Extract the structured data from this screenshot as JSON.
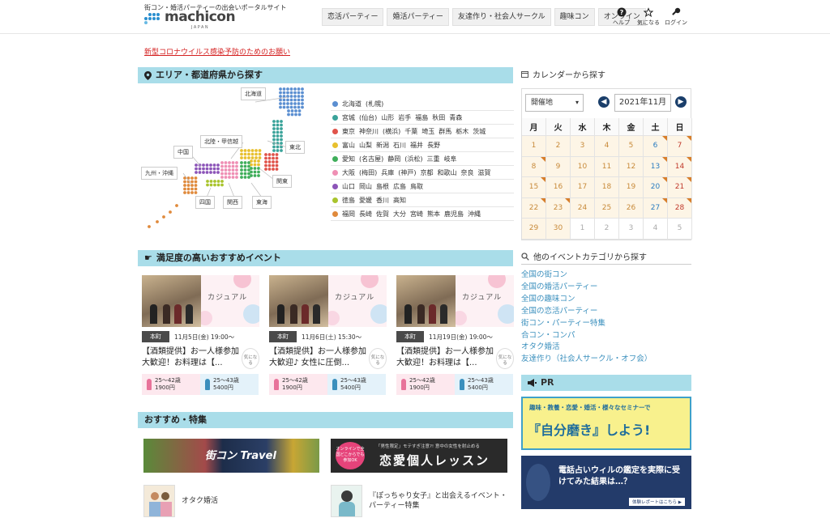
{
  "header": {
    "tagline": "街コン・婚活パーティーの出会いポータルサイト",
    "logo_text": "machicon",
    "logo_sub": "JAPAN",
    "nav": [
      "恋活パーティー",
      "婚活パーティー",
      "友達作り・社会人サークル",
      "趣味コン",
      "オンライン"
    ],
    "help": "ヘルプ",
    "favorite": "気になる",
    "login": "ログイン"
  },
  "notice": "新型コロナウイルス感染予防のためのお願い",
  "area": {
    "heading": "エリア・都道府県から探す",
    "map_labels": {
      "hokkaido": "北海道",
      "tohoku": "東北",
      "hokuriku": "北陸・甲信越",
      "chugoku": "中国",
      "kyushu": "九州・沖縄",
      "shikoku": "四国",
      "kansai": "関西",
      "tokai": "東海",
      "kanto": "関東"
    },
    "regions": [
      {
        "color": "#5b8fd1",
        "prefs": [
          "北海道",
          "(札幌)"
        ]
      },
      {
        "color": "#3aa39a",
        "prefs": [
          "宮城",
          "(仙台)",
          "山形",
          "岩手",
          "福島",
          "秋田",
          "青森"
        ]
      },
      {
        "color": "#e0534a",
        "prefs": [
          "東京",
          "神奈川",
          "(横浜)",
          "千葉",
          "埼玉",
          "群馬",
          "栃木",
          "茨城"
        ]
      },
      {
        "color": "#e8c02e",
        "prefs": [
          "富山",
          "山梨",
          "新潟",
          "石川",
          "福井",
          "長野"
        ]
      },
      {
        "color": "#3fae5a",
        "prefs": [
          "愛知",
          "(名古屋)",
          "静岡",
          "(浜松)",
          "三重",
          "岐阜"
        ]
      },
      {
        "color": "#ef8fb4",
        "prefs": [
          "大阪",
          "(梅田)",
          "兵庫",
          "(神戸)",
          "京都",
          "和歌山",
          "奈良",
          "滋賀"
        ]
      },
      {
        "color": "#8c55b8",
        "prefs": [
          "山口",
          "岡山",
          "島根",
          "広島",
          "鳥取"
        ]
      },
      {
        "color": "#a9c42d",
        "prefs": [
          "徳島",
          "愛媛",
          "香川",
          "高知"
        ]
      },
      {
        "color": "#e08a3c",
        "prefs": [
          "福岡",
          "長崎",
          "佐賀",
          "大分",
          "宮崎",
          "熊本",
          "鹿児島",
          "沖縄"
        ]
      }
    ]
  },
  "events": {
    "heading": "満足度の高いおすすめイベント",
    "cards": [
      {
        "tag": "カジュアル",
        "location": "本町",
        "date": "11月5日(金) 19:00〜",
        "title": "【酒類提供】お一人様参加大歓迎！お料理は【...",
        "fav": "気になる",
        "female_age": "25〜42歳",
        "female_price": "1900円",
        "male_age": "25〜43歳",
        "male_price": "5400円"
      },
      {
        "tag": "カジュアル",
        "location": "本町",
        "date": "11月6日(土) 15:30〜",
        "title": "【酒類提供】お一人様参加大歓迎♪ 女性に圧倒...",
        "fav": "気になる",
        "female_age": "25〜42歳",
        "female_price": "1900円",
        "male_age": "25〜43歳",
        "male_price": "5400円"
      },
      {
        "tag": "カジュアル",
        "location": "本町",
        "date": "11月19日(金) 19:00〜",
        "title": "【酒類提供】お一人様参加大歓迎！お料理は【...",
        "fav": "気になる",
        "female_age": "25〜42歳",
        "female_price": "1900円",
        "male_age": "25〜43歳",
        "male_price": "5400円"
      }
    ]
  },
  "recommend": {
    "heading": "おすすめ・特集",
    "banner1_text": "街コン Travel",
    "banner2_small": "オンラインで全国どこからでも参加OK",
    "banner2_top": "「男性限定」モテすぎ注意?! 意中の女性を射止める",
    "banner2_text": "恋愛個人レッスン",
    "item1": "オタク婚活",
    "item2": "『ぽっちゃり女子』と出会えるイベント・パーティー特集"
  },
  "calendar": {
    "heading": "カレンダーから探す",
    "select": "開催地",
    "month": "2021年11月",
    "weekdays": [
      "月",
      "火",
      "水",
      "木",
      "金",
      "土",
      "日"
    ],
    "days": [
      "1",
      "2",
      "3",
      "4",
      "5",
      "6",
      "7",
      "8",
      "9",
      "10",
      "11",
      "12",
      "13",
      "14",
      "15",
      "16",
      "17",
      "18",
      "19",
      "20",
      "21",
      "22",
      "23",
      "24",
      "25",
      "26",
      "27",
      "28",
      "29",
      "30",
      "1",
      "2",
      "3",
      "4",
      "5"
    ]
  },
  "categories": {
    "heading": "他のイベントカテゴリから探す",
    "links": [
      "全国の街コン",
      "全国の婚活パーティー",
      "全国の趣味コン",
      "全国の恋活パーティー",
      "街コン・パーティー特集",
      "合コン・コンパ",
      "オタク婚活",
      "友達作り（社会人サークル・オフ会）"
    ]
  },
  "pr": {
    "heading": "PR",
    "banner1_top": "趣味・教養・恋愛・婚活・様々なセミナーで",
    "banner1_main": "『自分磨き』しよう!",
    "banner2_main": "電話占いウィルの鑑定を実際に受けてみた結果は…？",
    "banner2_btn": "体験レポートはこちら ▶"
  },
  "colors": {
    "section_bar": "#a9dde9",
    "link": "#3a8fbd",
    "alert": "#d42020"
  }
}
